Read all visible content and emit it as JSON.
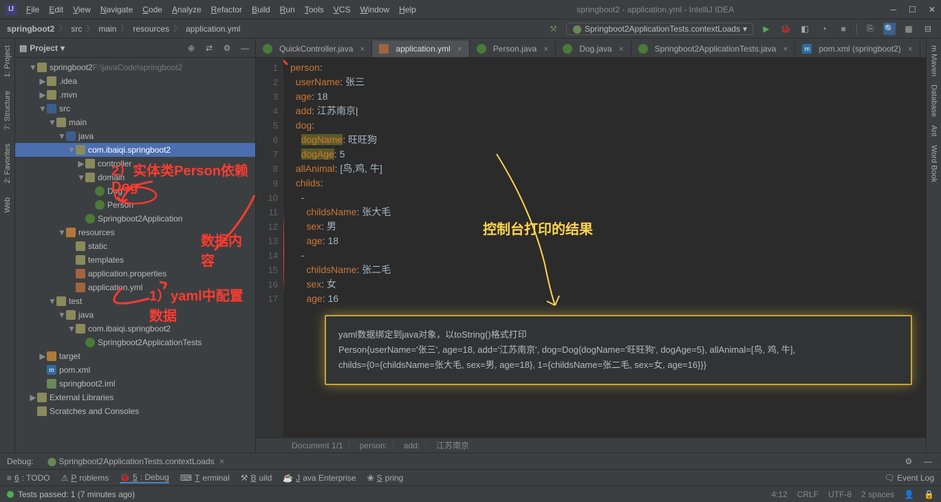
{
  "window": {
    "title": "springboot2 - application.yml - IntelliJ IDEA"
  },
  "menus": [
    "File",
    "Edit",
    "View",
    "Navigate",
    "Code",
    "Analyze",
    "Refactor",
    "Build",
    "Run",
    "Tools",
    "VCS",
    "Window",
    "Help"
  ],
  "breadcrumb": [
    "springboot2",
    "src",
    "main",
    "resources",
    "application.yml"
  ],
  "run_config": "Springboot2ApplicationTests.contextLoads",
  "project_panel": {
    "title": "Project"
  },
  "left_tabs": [
    "1: Project",
    "7: Structure",
    "2: Favorites",
    "Web"
  ],
  "right_tabs": [
    "Maven",
    "Database",
    "Ant",
    "Word Book"
  ],
  "tree": {
    "root": {
      "name": "springboot2",
      "path": "F:\\javaCode\\springboot2"
    },
    "items": [
      {
        "d": 1,
        "tw": "▼",
        "ic": "folder",
        "label": "springboot2",
        "suffix": "F:\\javaCode\\springboot2"
      },
      {
        "d": 2,
        "tw": "▶",
        "ic": "folder",
        "label": ".idea"
      },
      {
        "d": 2,
        "tw": "▶",
        "ic": "folder",
        "label": ".mvn"
      },
      {
        "d": 2,
        "tw": "▼",
        "ic": "folder-blue",
        "label": "src"
      },
      {
        "d": 3,
        "tw": "▼",
        "ic": "folder",
        "label": "main"
      },
      {
        "d": 4,
        "tw": "▼",
        "ic": "folder-blue",
        "label": "java"
      },
      {
        "d": 5,
        "tw": "▼",
        "ic": "folder",
        "label": "com.ibaiqi.springboot2",
        "sel": true
      },
      {
        "d": 6,
        "tw": "▶",
        "ic": "folder",
        "label": "controller"
      },
      {
        "d": 6,
        "tw": "▼",
        "ic": "folder",
        "label": "domain"
      },
      {
        "d": 7,
        "tw": "",
        "ic": "class",
        "label": "Dog"
      },
      {
        "d": 7,
        "tw": "",
        "ic": "class",
        "label": "Person"
      },
      {
        "d": 6,
        "tw": "",
        "ic": "class",
        "label": "Springboot2Application"
      },
      {
        "d": 4,
        "tw": "▼",
        "ic": "folder-orange",
        "label": "resources"
      },
      {
        "d": 5,
        "tw": "",
        "ic": "folder",
        "label": "static"
      },
      {
        "d": 5,
        "tw": "",
        "ic": "folder",
        "label": "templates"
      },
      {
        "d": 5,
        "tw": "",
        "ic": "yml",
        "label": "application.properties"
      },
      {
        "d": 5,
        "tw": "",
        "ic": "yml",
        "label": "application.yml"
      },
      {
        "d": 3,
        "tw": "▼",
        "ic": "folder",
        "label": "test"
      },
      {
        "d": 4,
        "tw": "▼",
        "ic": "folder",
        "label": "java"
      },
      {
        "d": 5,
        "tw": "▼",
        "ic": "folder",
        "label": "com.ibaiqi.springboot2"
      },
      {
        "d": 6,
        "tw": "",
        "ic": "class",
        "label": "Springboot2ApplicationTests"
      },
      {
        "d": 2,
        "tw": "▶",
        "ic": "folder-orange",
        "label": "target"
      },
      {
        "d": 2,
        "tw": "",
        "ic": "m",
        "label": "pom.xml"
      },
      {
        "d": 2,
        "tw": "",
        "ic": "file",
        "label": "springboot2.iml"
      },
      {
        "d": 1,
        "tw": "▶",
        "ic": "folder",
        "label": "External Libraries"
      },
      {
        "d": 1,
        "tw": "",
        "ic": "folder",
        "label": "Scratches and Consoles"
      }
    ]
  },
  "editor_tabs": [
    {
      "icon": "class",
      "label": "QuickController.java",
      "active": false
    },
    {
      "icon": "yml",
      "label": "application.yml",
      "active": true
    },
    {
      "icon": "class",
      "label": "Person.java",
      "active": false
    },
    {
      "icon": "class",
      "label": "Dog.java",
      "active": false
    },
    {
      "icon": "class",
      "label": "Springboot2ApplicationTests.java",
      "active": false
    },
    {
      "icon": "m",
      "label": "pom.xml (springboot2)",
      "active": false
    }
  ],
  "code": {
    "lines": [
      {
        "n": 1,
        "seg": [
          [
            "key",
            "person"
          ],
          [
            "val",
            ":"
          ]
        ]
      },
      {
        "n": 2,
        "seg": [
          [
            "ind",
            "  "
          ],
          [
            "key",
            "userName"
          ],
          [
            "val",
            ": 张三"
          ]
        ]
      },
      {
        "n": 3,
        "seg": [
          [
            "ind",
            "  "
          ],
          [
            "key",
            "age"
          ],
          [
            "val",
            ": 18"
          ]
        ]
      },
      {
        "n": 4,
        "seg": [
          [
            "ind",
            "  "
          ],
          [
            "key",
            "add"
          ],
          [
            "val",
            ": 江苏南京"
          ]
        ],
        "cursor": true
      },
      {
        "n": 5,
        "seg": [
          [
            "ind",
            "  "
          ],
          [
            "key",
            "dog"
          ],
          [
            "val",
            ":"
          ]
        ]
      },
      {
        "n": 6,
        "seg": [
          [
            "ind",
            "    "
          ],
          [
            "keyhl",
            "dogName"
          ],
          [
            "val",
            ": 旺旺狗"
          ]
        ]
      },
      {
        "n": 7,
        "seg": [
          [
            "ind",
            "    "
          ],
          [
            "keyhl",
            "dogAge"
          ],
          [
            "val",
            ": 5"
          ]
        ]
      },
      {
        "n": 8,
        "seg": [
          [
            "ind",
            "  "
          ],
          [
            "key",
            "allAnimal"
          ],
          [
            "val",
            ": [鸟,鸡, 牛]"
          ]
        ]
      },
      {
        "n": 9,
        "seg": [
          [
            "ind",
            "  "
          ],
          [
            "key",
            "childs"
          ],
          [
            "val",
            ":"
          ]
        ]
      },
      {
        "n": 10,
        "seg": [
          [
            "ind",
            "    "
          ],
          [
            "val",
            "-"
          ]
        ]
      },
      {
        "n": 11,
        "seg": [
          [
            "ind",
            "      "
          ],
          [
            "key",
            "childsName"
          ],
          [
            "val",
            ": 张大毛"
          ]
        ]
      },
      {
        "n": 12,
        "seg": [
          [
            "ind",
            "      "
          ],
          [
            "key",
            "sex"
          ],
          [
            "val",
            ": 男"
          ]
        ]
      },
      {
        "n": 13,
        "seg": [
          [
            "ind",
            "      "
          ],
          [
            "key",
            "age"
          ],
          [
            "val",
            ": 18"
          ]
        ]
      },
      {
        "n": 14,
        "seg": [
          [
            "ind",
            "    "
          ],
          [
            "val",
            "-"
          ]
        ]
      },
      {
        "n": 15,
        "seg": [
          [
            "ind",
            "      "
          ],
          [
            "key",
            "childsName"
          ],
          [
            "val",
            ": 张二毛"
          ]
        ]
      },
      {
        "n": 16,
        "seg": [
          [
            "ind",
            "      "
          ],
          [
            "key",
            "sex"
          ],
          [
            "val",
            ": 女"
          ]
        ]
      },
      {
        "n": 17,
        "seg": [
          [
            "ind",
            "      "
          ],
          [
            "key",
            "age"
          ],
          [
            "val",
            ": 16"
          ]
        ]
      }
    ]
  },
  "console": {
    "line1": "yaml数据绑定到java对象，以toString()格式打印",
    "line2": "Person{userName='张三', age=18, add='江苏南京', dog=Dog{dogName='旺旺狗', dogAge=5}, allAnimal=[鸟, 鸡, 牛],",
    "line3": " childs={0={childsName=张大毛, sex=男, age=18}, 1={childsName=张二毛, sex=女, age=16}}}"
  },
  "annotations": {
    "a1": "2）实体类Person依赖Dog",
    "a2": "数据内容",
    "a3": "1）yaml中配置数据",
    "a4": "控制台打印的结果"
  },
  "editor_status": {
    "doc": "Document 1/1",
    "crumb1": "person:",
    "crumb2": "add:",
    "crumb3": "江苏南京"
  },
  "debug": {
    "label": "Debug:",
    "config": "Springboot2ApplicationTests.contextLoads"
  },
  "bottom_tabs": [
    "6: TODO",
    "Problems",
    "5: Debug",
    "Terminal",
    "Build",
    "Java Enterprise",
    "Spring"
  ],
  "bottom_active": 2,
  "event_log": "Event Log",
  "status": {
    "msg": "Tests passed: 1 (7 minutes ago)",
    "pos": "4:12",
    "eol": "CRLF",
    "enc": "UTF-8",
    "indent": "2 spaces"
  }
}
